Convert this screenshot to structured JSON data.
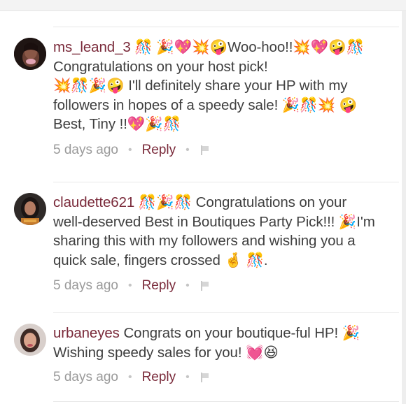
{
  "comments": [
    {
      "username": "ms_leand_3",
      "text_parts": [
        " 🎊 🎉💖💥🤪Woo-hoo!!💥💖🤪🎊",
        "Congratulations on your host pick!",
        "💥🎊🎉🤪 I'll definitely share your HP with my",
        "followers in hopes of a speedy sale! 🎉🎊💥 🤪",
        "Best, Tiny !!💖🎉🎊"
      ],
      "time": "5 days ago",
      "reply": "Reply"
    },
    {
      "username": "claudette621",
      "text_parts": [
        " 🎊🎉🎊 Congratulations on your",
        "well-deserved Best in Boutiques Party Pick!!! 🎉I'm",
        "sharing this with my followers and wishing you a",
        "quick sale, fingers crossed 🤞 🎊."
      ],
      "time": "5 days ago",
      "reply": "Reply"
    },
    {
      "username": "urbaneyes",
      "text_parts": [
        " Congrats on your boutique-ful HP! 🎉",
        "Wishing speedy sales for you! 💓😆"
      ],
      "time": "5 days ago",
      "reply": "Reply"
    }
  ],
  "colors": {
    "username": "#7a2a3a",
    "reply": "#7a2a3a",
    "body_text": "#3f3f3f",
    "meta_text": "#9a9a9a"
  },
  "icons": [
    "avatar",
    "flag-icon"
  ]
}
